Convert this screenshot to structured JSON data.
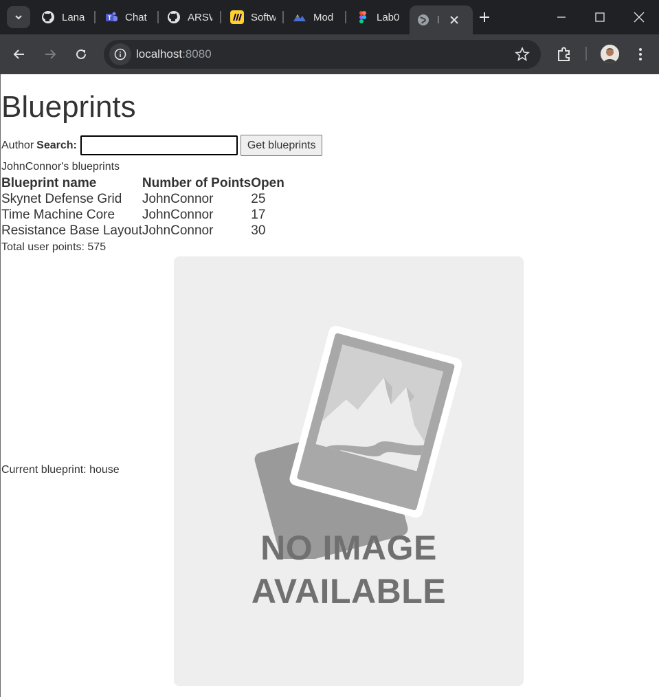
{
  "browser": {
    "tabs": [
      {
        "label": "Lana",
        "icon": "github-icon"
      },
      {
        "label": "Chat",
        "icon": "teams-icon"
      },
      {
        "label": "ARSW",
        "icon": "github-icon"
      },
      {
        "label": "Softw",
        "icon": "miro-icon"
      },
      {
        "label": "Mod",
        "icon": "mountain-icon"
      },
      {
        "label": "Lab0",
        "icon": "figma-icon"
      },
      {
        "label": "l",
        "icon": "globe-icon",
        "active": true
      }
    ],
    "url_host": "localhost",
    "url_port": ":8080"
  },
  "page": {
    "title": "Blueprints",
    "search": {
      "label_plain": "Author",
      "label_bold": "Search:",
      "value": "",
      "button_label": "Get blueprints"
    },
    "owner_heading": "JohnConnor's blueprints",
    "table": {
      "headers": [
        "Blueprint name",
        "Number of Points",
        "Open"
      ],
      "rows": [
        [
          "Skynet Defense Grid",
          "JohnConnor",
          "25"
        ],
        [
          "Time Machine Core",
          "JohnConnor",
          "17"
        ],
        [
          "Resistance Base Layout",
          "JohnConnor",
          "30"
        ]
      ]
    },
    "total_points": "Total user points: 575",
    "current_blueprint": "Current blueprint: house",
    "placeholder": {
      "line1": "NO IMAGE",
      "line2": "AVAILABLE"
    }
  },
  "colors": {
    "chrome_dark": "#202124",
    "toolbar": "#3c3d40",
    "text": "#333333",
    "placeholder_bg": "#eeeeee"
  }
}
